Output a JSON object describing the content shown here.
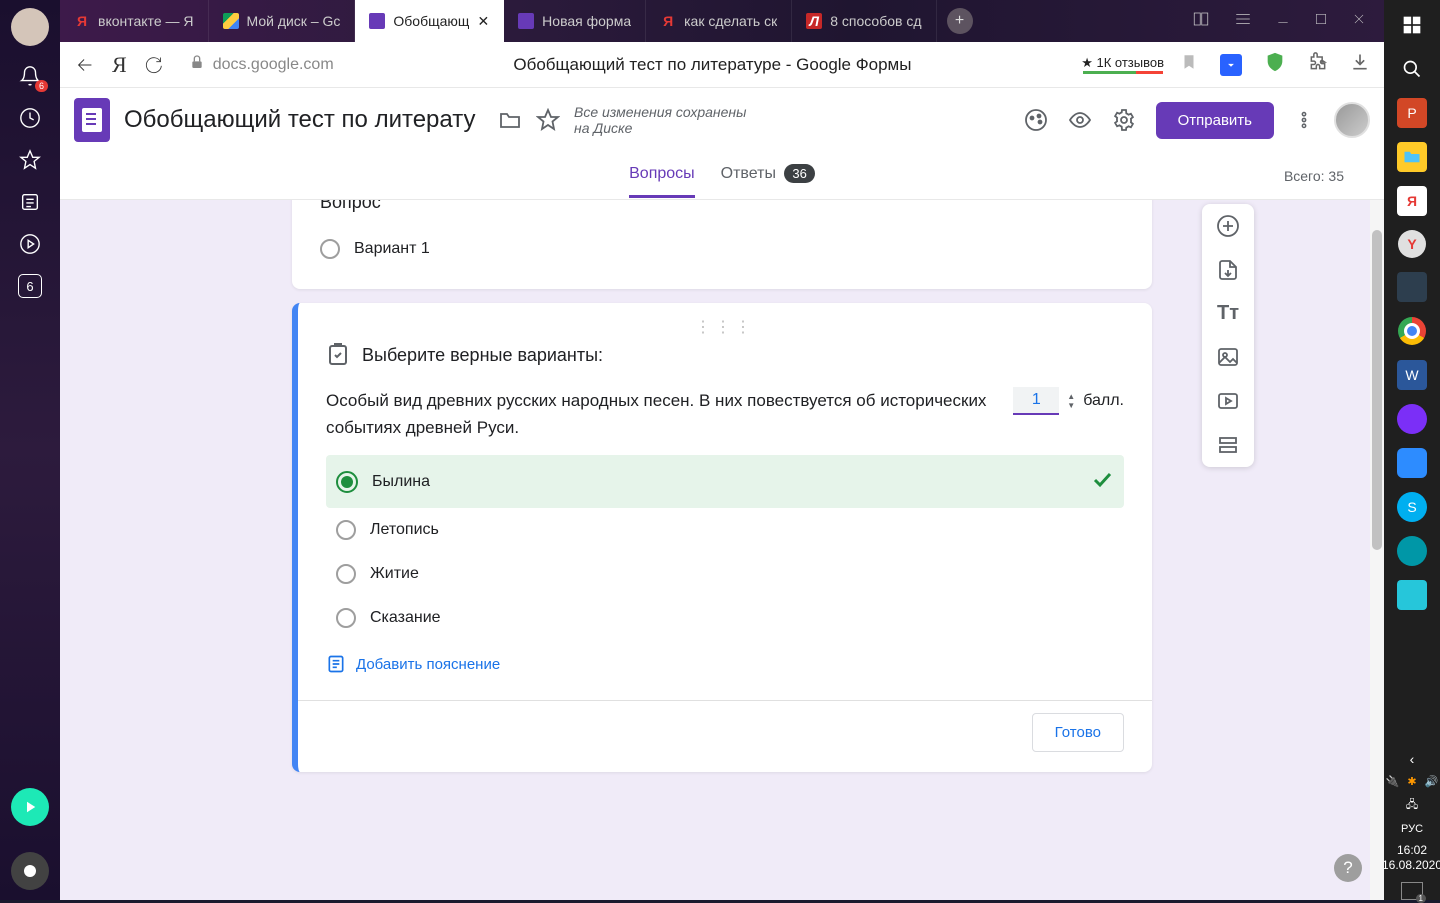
{
  "browser": {
    "notif_badge": "6",
    "square_badge": "6",
    "tabs": [
      {
        "label": "вконтакте — Я",
        "favicon": "yandex"
      },
      {
        "label": "Мой диск – Gс",
        "favicon": "drive"
      },
      {
        "label": "Обобщающ",
        "favicon": "gforms",
        "active": true
      },
      {
        "label": "Новая форма",
        "favicon": "gforms"
      },
      {
        "label": "как сделать ск",
        "favicon": "yandex"
      },
      {
        "label": "8 способов сд",
        "favicon": "liveinternet"
      }
    ],
    "url": "docs.google.com",
    "page_title": "Обобщающий тест по литературе - Google Формы",
    "rating": "★ 1К отзывов"
  },
  "gforms": {
    "title": "Обобщающий тест по литерату",
    "saved": "Все изменения сохранены на Диске",
    "send": "Отправить",
    "tabs": {
      "questions": "Вопросы",
      "responses": "Ответы",
      "resp_count": "36"
    },
    "total": "Всего: 35",
    "prev_q": {
      "label": "Вопрос",
      "option": "Вариант 1"
    },
    "active_q": {
      "key_title": "Выберите верные варианты:",
      "text": "Особый вид древних русских народных песен. В них повествуется об исторических событиях древней Руси.",
      "points": "1",
      "points_label": "балл.",
      "answers": [
        "Былина",
        "Летопись",
        "Житие",
        "Сказание"
      ],
      "add_expl": "Добавить пояснение",
      "done": "Готово"
    }
  },
  "taskbar": {
    "lang": "РУС",
    "time": "16:02",
    "date": "16.08.2020",
    "notif_count": "1"
  }
}
